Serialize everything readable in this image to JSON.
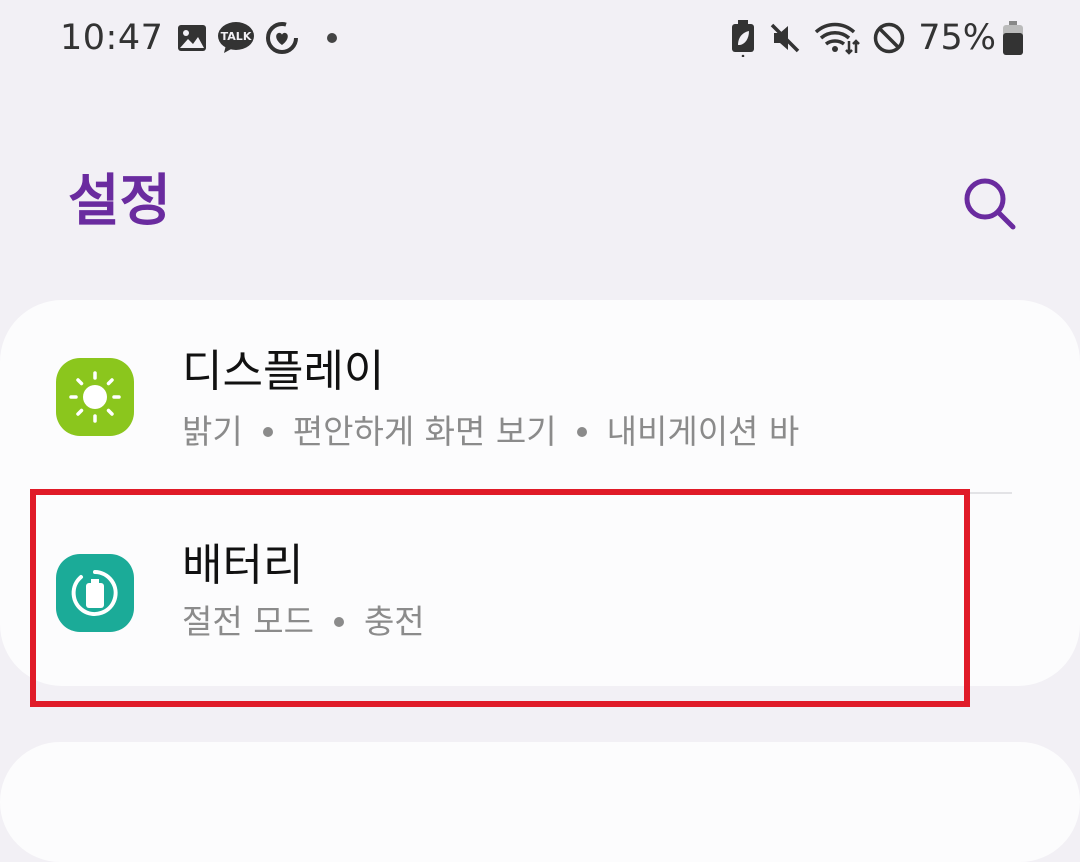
{
  "status_bar": {
    "time": "10:47",
    "battery_percent": "75%",
    "left_icons": [
      "gallery-icon",
      "kakaotalk-icon",
      "health-icon"
    ],
    "right_icons": [
      "battery-saver-icon",
      "mute-icon",
      "wifi-icon",
      "do-not-disturb-icon",
      "battery-icon"
    ]
  },
  "header": {
    "title": "설정",
    "search_icon": "search-icon"
  },
  "settings": {
    "items": [
      {
        "icon": "display-icon",
        "title": "디스플레이",
        "subtitle_parts": [
          "밝기",
          "편안하게 화면 보기",
          "내비게이션 바"
        ]
      },
      {
        "icon": "battery-settings-icon",
        "title": "배터리",
        "subtitle_parts": [
          "절전 모드",
          "충전"
        ]
      }
    ]
  },
  "colors": {
    "accent": "#6a2b9f",
    "display_icon_bg": "#8bc61d",
    "battery_icon_bg": "#1bab98",
    "highlight": "#e01b28",
    "background": "#f2f0f5",
    "card": "#fcfcfd"
  }
}
